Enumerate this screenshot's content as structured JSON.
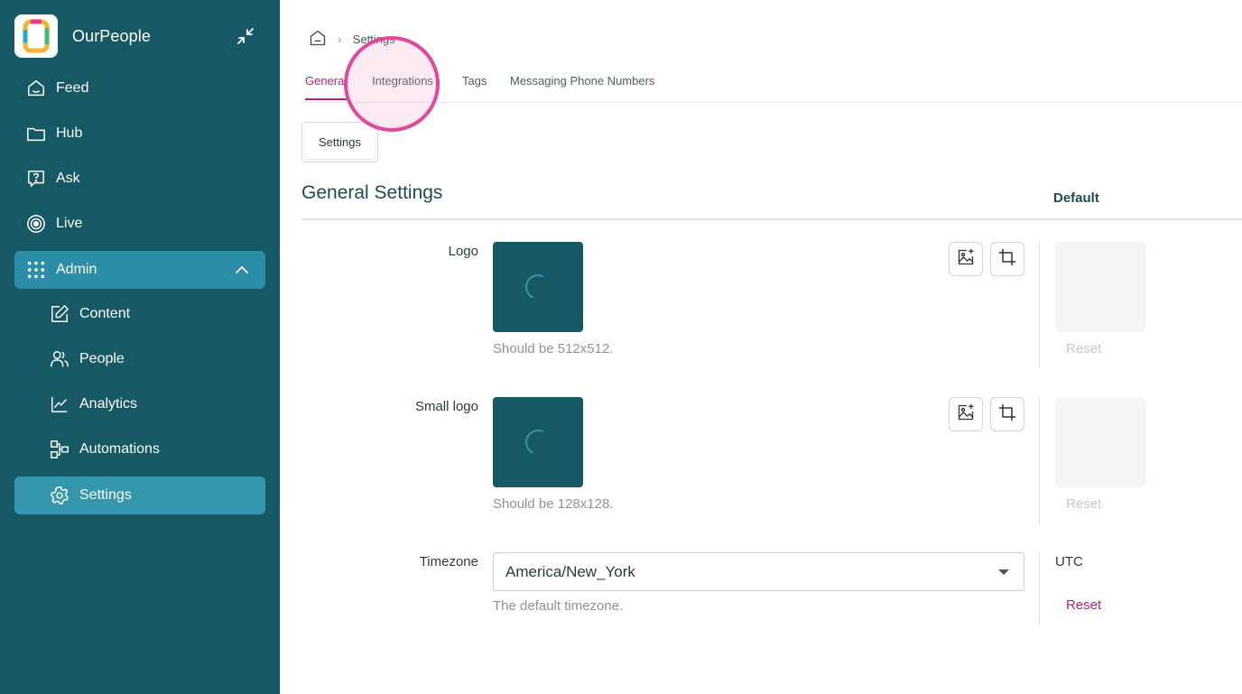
{
  "app": {
    "name": "OurPeople"
  },
  "sidebar": {
    "items": [
      {
        "label": "Feed"
      },
      {
        "label": "Hub"
      },
      {
        "label": "Ask"
      },
      {
        "label": "Live"
      },
      {
        "label": "Admin"
      },
      {
        "label": "Content"
      },
      {
        "label": "People"
      },
      {
        "label": "Analytics"
      },
      {
        "label": "Automations"
      },
      {
        "label": "Settings"
      }
    ]
  },
  "breadcrumb": {
    "current": "Settings"
  },
  "tabs": [
    {
      "label": "General"
    },
    {
      "label": "Integrations"
    },
    {
      "label": "Tags"
    },
    {
      "label": "Messaging Phone Numbers"
    }
  ],
  "subtabs": [
    {
      "label": "Settings"
    }
  ],
  "section": {
    "title": "General Settings",
    "default_header": "Default"
  },
  "fields": {
    "logo": {
      "label": "Logo",
      "hint": "Should be 512x512.",
      "reset": "Reset"
    },
    "small_logo": {
      "label": "Small logo",
      "hint": "Should be 128x128.",
      "reset": "Reset"
    },
    "timezone": {
      "label": "Timezone",
      "value": "America/New_York",
      "hint": "The default timezone.",
      "default": "UTC",
      "reset": "Reset"
    }
  },
  "colors": {
    "sidebar_bg": "#175865",
    "sidebar_active": "#3597ae",
    "accent": "#b8246b",
    "click_indicator": "#e0499a"
  }
}
